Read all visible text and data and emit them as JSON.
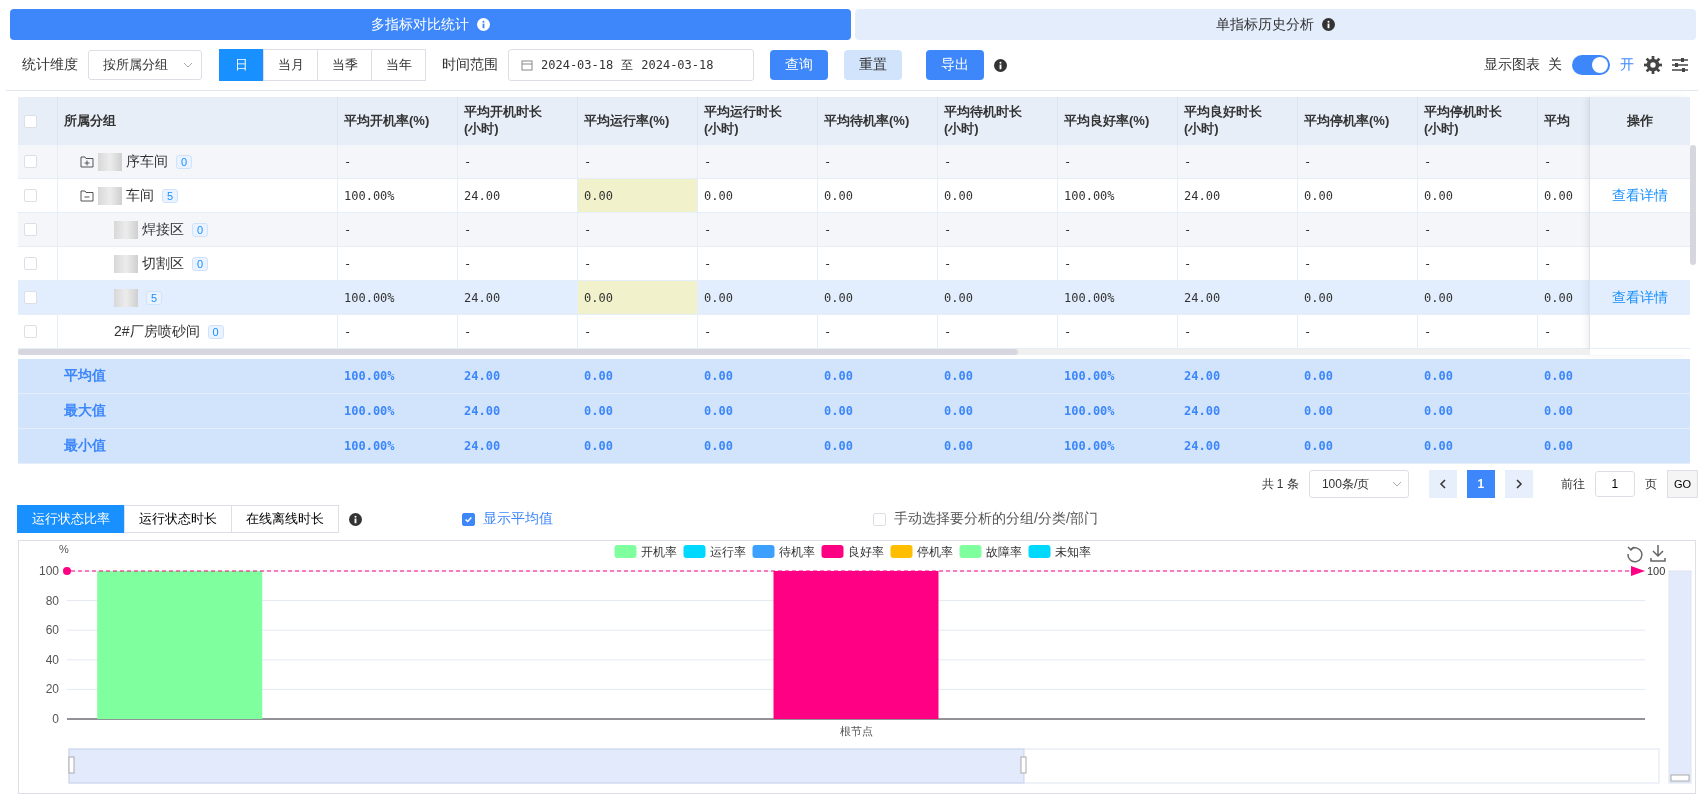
{
  "tabs": [
    {
      "label": "多指标对比统计",
      "selected": true
    },
    {
      "label": "单指标历史分析",
      "selected": false
    }
  ],
  "filters": {
    "dimension_label": "统计维度",
    "dimension_value": "按所属分组",
    "periods": [
      {
        "label": "日",
        "selected": true
      },
      {
        "label": "当月",
        "selected": false
      },
      {
        "label": "当季",
        "selected": false
      },
      {
        "label": "当年",
        "selected": false
      }
    ],
    "range_label": "时间范围",
    "start_date": "2024-03-18",
    "range_separator": "至",
    "end_date": "2024-03-18"
  },
  "buttons": [
    {
      "label": "查询",
      "kind": "primary"
    },
    {
      "label": "重置",
      "kind": "secondary"
    },
    {
      "label": "导出",
      "kind": "primary"
    }
  ],
  "chart_toggle": {
    "label": "显示图表",
    "off_label": "关",
    "on_label": "开",
    "on": true
  },
  "table": {
    "group_header": "所属分组",
    "columns": [
      "平均开机率(%)",
      "平均开机时长(小时)",
      "平均运行率(%)",
      "平均运行时长(小时)",
      "平均待机率(%)",
      "平均待机时长(小时)",
      "平均良好率(%)",
      "平均良好时长(小时)",
      "平均停机率(%)",
      "平均停机时长(小时)",
      "平均"
    ],
    "action_header": "操作",
    "header_checked": false,
    "rows": [
      {
        "name": "序车间",
        "count": "0",
        "redacted": true,
        "expanded": false,
        "checked": false,
        "selected": false,
        "run_rate_flagged": false,
        "cells": [
          "-",
          "-",
          "-",
          "-",
          "-",
          "-",
          "-",
          "-",
          "-",
          "-",
          "-"
        ]
      },
      {
        "name": "车间",
        "count": "5",
        "redacted": true,
        "expanded": true,
        "checked": false,
        "selected": false,
        "run_rate_flagged": true,
        "cells": [
          "100.00%",
          "24.00",
          "0.00",
          "0.00",
          "0.00",
          "0.00",
          "100.00%",
          "24.00",
          "0.00",
          "0.00",
          "0.00"
        ],
        "action": "查看详情",
        "children": [
          {
            "name": "焊接区",
            "count": "0",
            "redacted": true,
            "checked": false,
            "selected": false,
            "run_rate_flagged": false,
            "cells": [
              "-",
              "-",
              "-",
              "-",
              "-",
              "-",
              "-",
              "-",
              "-",
              "-",
              "-"
            ]
          },
          {
            "name": "切割区",
            "count": "0",
            "redacted": true,
            "checked": false,
            "selected": false,
            "run_rate_flagged": false,
            "cells": [
              "-",
              "-",
              "-",
              "-",
              "-",
              "-",
              "-",
              "-",
              "-",
              "-",
              "-"
            ]
          },
          {
            "count": "5",
            "redacted": true,
            "checked": false,
            "selected": true,
            "run_rate_flagged": true,
            "cells": [
              "100.00%",
              "24.00",
              "0.00",
              "0.00",
              "0.00",
              "0.00",
              "100.00%",
              "24.00",
              "0.00",
              "0.00",
              "0.00"
            ],
            "action": "查看详情"
          },
          {
            "name": "2#厂房喷砂间",
            "count": "0",
            "redacted": false,
            "checked": false,
            "selected": false,
            "run_rate_flagged": false,
            "cells": [
              "-",
              "-",
              "-",
              "-",
              "-",
              "-",
              "-",
              "-",
              "-",
              "-",
              "-"
            ]
          }
        ]
      }
    ],
    "summary": [
      {
        "label": "平均值",
        "cells": [
          "100.00%",
          "24.00",
          "0.00",
          "0.00",
          "0.00",
          "0.00",
          "100.00%",
          "24.00",
          "0.00",
          "0.00",
          "0.00"
        ]
      },
      {
        "label": "最大值",
        "cells": [
          "100.00%",
          "24.00",
          "0.00",
          "0.00",
          "0.00",
          "0.00",
          "100.00%",
          "24.00",
          "0.00",
          "0.00",
          "0.00"
        ]
      },
      {
        "label": "最小值",
        "cells": [
          "100.00%",
          "24.00",
          "0.00",
          "0.00",
          "0.00",
          "0.00",
          "100.00%",
          "24.00",
          "0.00",
          "0.00",
          "0.00"
        ]
      }
    ]
  },
  "pagination": {
    "total": "共 1 条",
    "page_size": "100条/页",
    "pages": [
      {
        "label": "1",
        "selected": true
      }
    ],
    "goto_label": "前往",
    "goto_value": "1",
    "page_unit": "页",
    "go_button": "GO"
  },
  "chart_tabs": [
    {
      "label": "运行状态比率",
      "selected": true
    },
    {
      "label": "运行状态时长",
      "selected": false
    },
    {
      "label": "在线离线时长",
      "selected": false
    }
  ],
  "show_average": {
    "label": "显示平均值",
    "checked": true
  },
  "manual_select": {
    "label": "手动选择要分析的分组/分类/部门",
    "checked": false
  },
  "chart": {
    "chart_data": {
      "type": "bar",
      "ylabel": "%",
      "categories": [
        "根节点"
      ],
      "ylim": [
        0,
        100
      ],
      "yticks": [
        0,
        20,
        40,
        60,
        80,
        100
      ],
      "grid": true,
      "legend": true,
      "series": [
        {
          "name": "开机率",
          "color": "#80ff9f",
          "values": [
            100
          ]
        },
        {
          "name": "运行率",
          "color": "#00d9ff",
          "values": [
            0
          ]
        },
        {
          "name": "待机率",
          "color": "#3ba0ff",
          "values": [
            0
          ]
        },
        {
          "name": "良好率",
          "color": "#ff0084",
          "values": [
            100
          ]
        },
        {
          "name": "停机率",
          "color": "#ffbf00",
          "values": [
            0
          ]
        },
        {
          "name": "故障率",
          "color": "#80ff9f",
          "values": [
            0
          ]
        },
        {
          "name": "未知率",
          "color": "#00d9ff",
          "values": [
            0
          ]
        }
      ],
      "ref_lines": [
        {
          "axis": "y",
          "value": 100,
          "label": "100",
          "color": "#ff0084"
        }
      ]
    }
  }
}
